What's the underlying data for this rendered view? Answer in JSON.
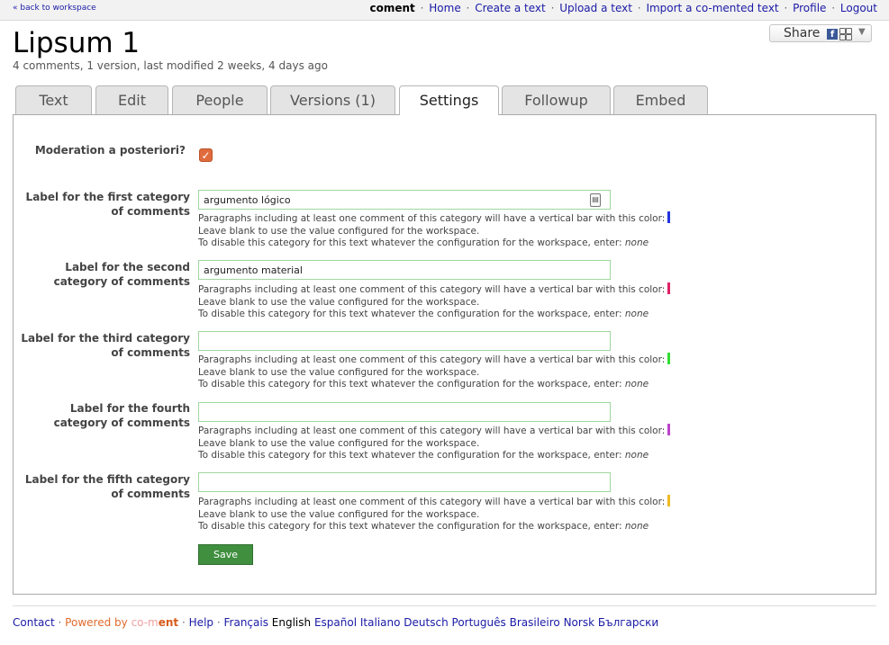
{
  "topbar": {
    "back": "« back to workspace",
    "brand": "coment",
    "links": [
      "Home",
      "Create a text",
      "Upload a text",
      "Import a co-mented text",
      "Profile",
      "Logout"
    ]
  },
  "header": {
    "title": "Lipsum 1",
    "subtitle": "4 comments, 1 version, last modified 2 weeks, 4 days ago",
    "share": "Share"
  },
  "tabs": [
    "Text",
    "Edit",
    "People",
    "Versions (1)",
    "Settings",
    "Followup",
    "Embed"
  ],
  "active_tab": "Settings",
  "form": {
    "moderation_label": "Moderation a posteriori?",
    "moderation_checked": true,
    "categories": [
      {
        "label": "Label for the first category of comments",
        "value": "argumento lógico",
        "color": "#2233dd"
      },
      {
        "label": "Label for the second category of comments",
        "value": "argumento material",
        "color": "#dd2266"
      },
      {
        "label": "Label for the third category of comments",
        "value": "",
        "color": "#33dd33"
      },
      {
        "label": "Label for the fourth category of comments",
        "value": "",
        "color": "#bb44cc"
      },
      {
        "label": "Label for the fifth category of comments",
        "value": "",
        "color": "#eebb22"
      }
    ],
    "help_line1": "Paragraphs including at least one comment of this category will have a vertical bar with this color:",
    "help_line2": "Leave blank to use the value configured for the workspace.",
    "help_line3": "To disable this category for this text whatever the configuration for the workspace, enter:",
    "help_none": "none",
    "save": "Save"
  },
  "footer": {
    "contact": "Contact",
    "powered": "Powered by",
    "logo_a": "co-m",
    "logo_b": "ent",
    "help": "Help",
    "languages": [
      "Français",
      "English",
      "Español",
      "Italiano",
      "Deutsch",
      "Português Brasileiro",
      "Norsk",
      "Български"
    ]
  }
}
